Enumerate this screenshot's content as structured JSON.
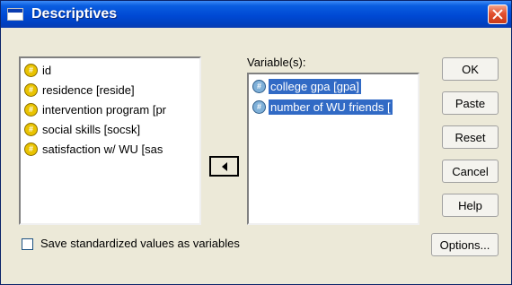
{
  "window": {
    "title": "Descriptives"
  },
  "source_list": {
    "items": [
      {
        "label": "id",
        "icon": "nominal-variable-icon"
      },
      {
        "label": "residence [reside]",
        "icon": "nominal-variable-icon"
      },
      {
        "label": "intervention program [pr",
        "icon": "nominal-variable-icon"
      },
      {
        "label": "social skills [socsk]",
        "icon": "nominal-variable-icon"
      },
      {
        "label": "satisfaction w/ WU [sas",
        "icon": "nominal-variable-icon"
      }
    ]
  },
  "variables": {
    "label": "Variable(s):",
    "items": [
      {
        "label": "college gpa [gpa]",
        "icon": "scale-variable-icon",
        "selected": true
      },
      {
        "label": "number of WU friends [",
        "icon": "scale-variable-icon",
        "selected": true
      }
    ]
  },
  "buttons": {
    "ok": "OK",
    "paste": "Paste",
    "reset": "Reset",
    "cancel": "Cancel",
    "help": "Help",
    "options": "Options..."
  },
  "save_checkbox": {
    "label": "Save standardized values as variables",
    "checked": false
  },
  "colors": {
    "titlebar": "#0049d4",
    "dialog_bg": "#ece9d8",
    "selection": "#316ac5"
  }
}
